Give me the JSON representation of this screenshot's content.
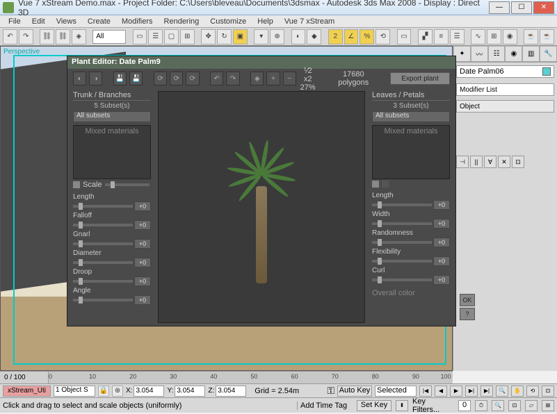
{
  "window": {
    "title": "Vue 7 xStream Demo.max  - Project Folder: C:\\Users\\bleveau\\Documents\\3dsmax  - Autodesk 3ds Max 2008  - Display : Direct 3D"
  },
  "menu": [
    "File",
    "Edit",
    "Views",
    "Create",
    "Modifiers",
    "Rendering",
    "Customize",
    "Help",
    "Vue 7 xStream"
  ],
  "toolbar1": {
    "combo": "All"
  },
  "viewport": {
    "label": "Perspective"
  },
  "plant_editor": {
    "title": "Plant Editor:  Date Palm9",
    "zoom_frac": "⅟2",
    "zoom_mult": "x2",
    "zoom_pct": "27%",
    "polygons": "17680 polygons",
    "export_label": "Export plant",
    "trunk": {
      "header": "Trunk / Branches",
      "subsets": "5 Subset(s)",
      "combo": "All subsets",
      "materials": "Mixed materials",
      "scale_label": "Scale",
      "params": [
        {
          "label": "Length",
          "value": "+0"
        },
        {
          "label": "Falloff",
          "value": "+0"
        },
        {
          "label": "Gnarl",
          "value": "+0"
        },
        {
          "label": "Diameter",
          "value": "+0"
        },
        {
          "label": "Droop",
          "value": "+0"
        },
        {
          "label": "Angle",
          "value": "+0"
        }
      ]
    },
    "leaves": {
      "header": "Leaves / Petals",
      "subsets": "3 Subset(s)",
      "combo": "All subsets",
      "materials": "Mixed materials",
      "params": [
        {
          "label": "Length",
          "value": "+0"
        },
        {
          "label": "Width",
          "value": "+0"
        },
        {
          "label": "Randomness",
          "value": "+0"
        },
        {
          "label": "Flexibility",
          "value": "+0"
        },
        {
          "label": "Curl",
          "value": "+0"
        }
      ],
      "overall_color": "Overall color"
    },
    "ok": "OK",
    "help": "?"
  },
  "cmd_panel": {
    "object_name": "Date Palm06",
    "modifier_list": "Modifier List",
    "stack_item": "Object"
  },
  "timeline": {
    "frame": "0 / 100",
    "ticks": [
      "0",
      "10",
      "20",
      "30",
      "40",
      "50",
      "60",
      "70",
      "80",
      "90",
      "100"
    ]
  },
  "status_bar": {
    "xstream": "xStream_Uti",
    "objsel": "1 Object S",
    "x": "3.054",
    "y": "3.054",
    "z": "3.054",
    "grid": "Grid = 2.54m",
    "autokey": "Auto Key",
    "selected": "Selected",
    "hint": "Click and drag to select and scale objects (uniformly)",
    "addtag": "Add Time Tag",
    "setkey": "Set Key",
    "keyfilters": "Key Filters..."
  }
}
